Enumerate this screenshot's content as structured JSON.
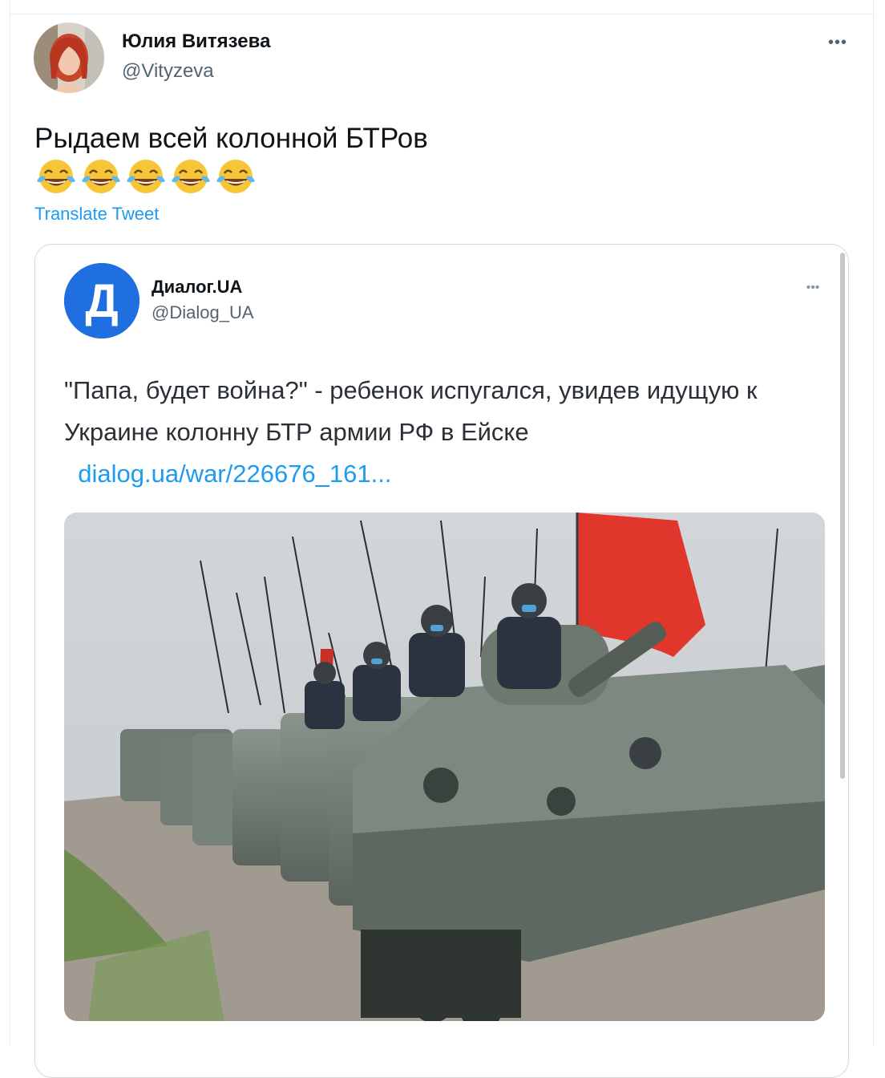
{
  "tweet": {
    "author_name": "Юлия Витязева",
    "author_handle": "@Vityzeva",
    "more_label": "•••",
    "text": "Рыдаем всей колонной БТРов",
    "emoji_count": 5,
    "emoji_icon": "face-with-tears-of-joy-icon",
    "translate_label": "Translate Tweet"
  },
  "quoted_tweet": {
    "avatar_letter": "Д",
    "author_name": "Диалог.UA",
    "author_handle": "@Dialog_UA",
    "more_label": "•••",
    "text": "\"Папа, будет война?\" - ребенок испугался, увидев идущую к Украине колонну БТР армии РФ в Ейске",
    "link_text": "dialog.ua/war/226676_161...",
    "avatar_color": "#1f6fe0"
  },
  "colors": {
    "link": "#1d9bf0",
    "secondary_text": "#536471",
    "border": "#cfd9de"
  }
}
